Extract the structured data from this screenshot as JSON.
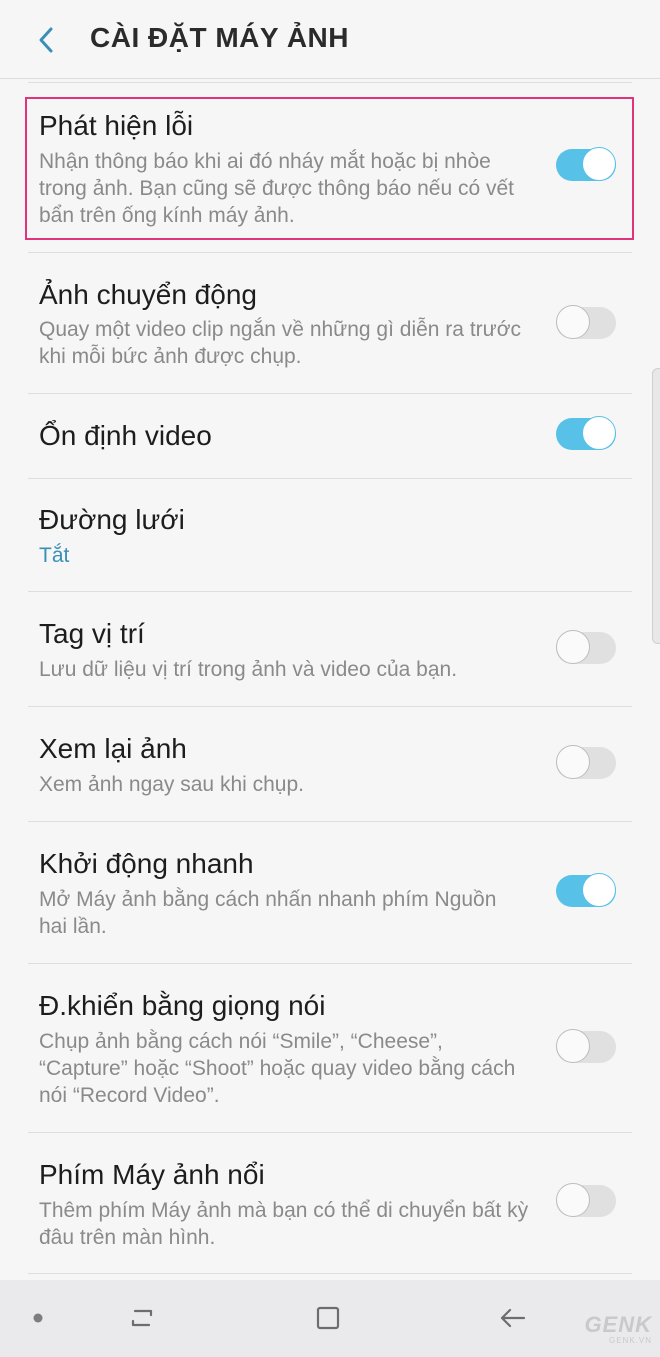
{
  "header": {
    "title": "CÀI ĐẶT MÁY ẢNH"
  },
  "settings": [
    {
      "title": "Phát hiện lỗi",
      "desc": "Nhận thông báo khi ai đó nháy mắt hoặc bị nhòe trong ảnh. Bạn cũng sẽ được thông báo nếu có vết bẩn trên ống kính máy ảnh.",
      "on": true
    },
    {
      "title": "Ảnh chuyển động",
      "desc": "Quay một video clip ngắn về những gì diễn ra trước khi mỗi bức ảnh được chụp.",
      "on": false
    },
    {
      "title": "Ổn định video",
      "on": true
    },
    {
      "title": "Đường lưới",
      "value": "Tắt"
    },
    {
      "title": "Tag vị trí",
      "desc": "Lưu dữ liệu vị trí trong ảnh và video của bạn.",
      "on": false
    },
    {
      "title": "Xem lại ảnh",
      "desc": "Xem ảnh ngay sau khi chụp.",
      "on": false
    },
    {
      "title": "Khởi động nhanh",
      "desc": "Mở Máy ảnh bằng cách nhấn nhanh phím Nguồn hai lần.",
      "on": true
    },
    {
      "title": "Đ.khiển bằng giọng nói",
      "desc": "Chụp ảnh bằng cách nói “Smile”, “Cheese”, “Capture” hoặc “Shoot” hoặc quay video bằng cách nói “Record Video”.",
      "on": false
    },
    {
      "title": "Phím Máy ảnh nổi",
      "desc": "Thêm phím Máy ảnh mà bạn có thể di chuyển bất kỳ đâu trên màn hình.",
      "on": false
    }
  ],
  "watermark": {
    "brand": "GENK",
    "domain": "GENK.VN"
  },
  "colors": {
    "accent": "#57c1e8",
    "highlight": "#e0357b",
    "value": "#3a8fb7"
  }
}
